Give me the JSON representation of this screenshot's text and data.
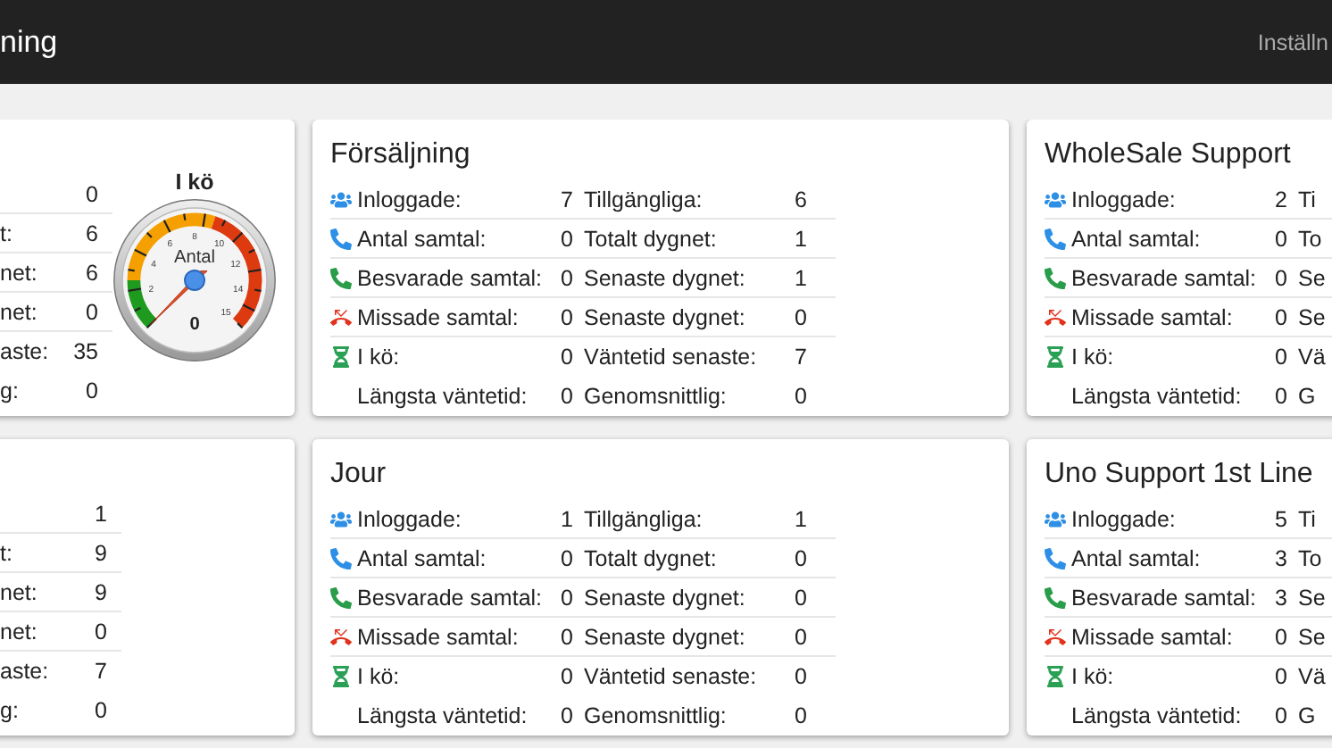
{
  "header": {
    "title": "ning",
    "settings_link": "Inställn"
  },
  "gauge_card": {
    "stats": [
      {
        "value": "0"
      },
      {
        "label": "t:",
        "value": "6"
      },
      {
        "label": "net:",
        "value": "6"
      },
      {
        "label": "net:",
        "value": "0"
      },
      {
        "label": "aste:",
        "value": "35"
      },
      {
        "label": "g:",
        "value": "0"
      }
    ],
    "gauge": {
      "title": "I kö",
      "caption": "Antal",
      "reading": "0",
      "scale_labels": [
        "2",
        "4",
        "6",
        "8",
        "10",
        "12",
        "14",
        "15"
      ]
    }
  },
  "cards": [
    {
      "title": "Försäljning",
      "rows": [
        {
          "label": "Inloggade:",
          "value": "7",
          "label2": "Tillgängliga:",
          "value2": "6"
        },
        {
          "label": "Antal samtal:",
          "value": "0",
          "label2": "Totalt dygnet:",
          "value2": "1"
        },
        {
          "label": "Besvarade samtal:",
          "value": "0",
          "label2": "Senaste dygnet:",
          "value2": "1"
        },
        {
          "label": "Missade samtal:",
          "value": "0",
          "label2": "Senaste dygnet:",
          "value2": "0"
        },
        {
          "label": "I kö:",
          "value": "0",
          "label2": "Väntetid senaste:",
          "value2": "7"
        },
        {
          "label": "Längsta väntetid:",
          "value": "0",
          "label2": "Genomsnittlig:",
          "value2": "0"
        }
      ]
    },
    {
      "title": "WholeSale Support",
      "rows": [
        {
          "label": "Inloggade:",
          "value": "2",
          "label2": "Ti"
        },
        {
          "label": "Antal samtal:",
          "value": "0",
          "label2": "To"
        },
        {
          "label": "Besvarade samtal:",
          "value": "0",
          "label2": "Se"
        },
        {
          "label": "Missade samtal:",
          "value": "0",
          "label2": "Se"
        },
        {
          "label": "I kö:",
          "value": "0",
          "label2": "Vä"
        },
        {
          "label": "Längsta väntetid:",
          "value": "0",
          "label2": "G"
        }
      ]
    },
    {
      "kind": "partial",
      "stats": [
        {
          "value": "1"
        },
        {
          "label": "t:",
          "value": "9"
        },
        {
          "label": "net:",
          "value": "9"
        },
        {
          "label": "net:",
          "value": "0"
        },
        {
          "label": "aste:",
          "value": "7"
        },
        {
          "label": "g:",
          "value": "0"
        }
      ]
    },
    {
      "title": "Jour",
      "rows": [
        {
          "label": "Inloggade:",
          "value": "1",
          "label2": "Tillgängliga:",
          "value2": "1"
        },
        {
          "label": "Antal samtal:",
          "value": "0",
          "label2": "Totalt dygnet:",
          "value2": "0"
        },
        {
          "label": "Besvarade samtal:",
          "value": "0",
          "label2": "Senaste dygnet:",
          "value2": "0"
        },
        {
          "label": "Missade samtal:",
          "value": "0",
          "label2": "Senaste dygnet:",
          "value2": "0"
        },
        {
          "label": "I kö:",
          "value": "0",
          "label2": "Väntetid senaste:",
          "value2": "0"
        },
        {
          "label": "Längsta väntetid:",
          "value": "0",
          "label2": "Genomsnittlig:",
          "value2": "0"
        }
      ]
    },
    {
      "title": "Uno Support 1st Line",
      "rows": [
        {
          "label": "Inloggade:",
          "value": "5",
          "label2": "Ti"
        },
        {
          "label": "Antal samtal:",
          "value": "3",
          "label2": "To"
        },
        {
          "label": "Besvarade samtal:",
          "value": "3",
          "label2": "Se"
        },
        {
          "label": "Missade samtal:",
          "value": "0",
          "label2": "Se"
        },
        {
          "label": "I kö:",
          "value": "0",
          "label2": "Vä"
        },
        {
          "label": "Längsta väntetid:",
          "value": "0",
          "label2": "G"
        }
      ]
    }
  ]
}
